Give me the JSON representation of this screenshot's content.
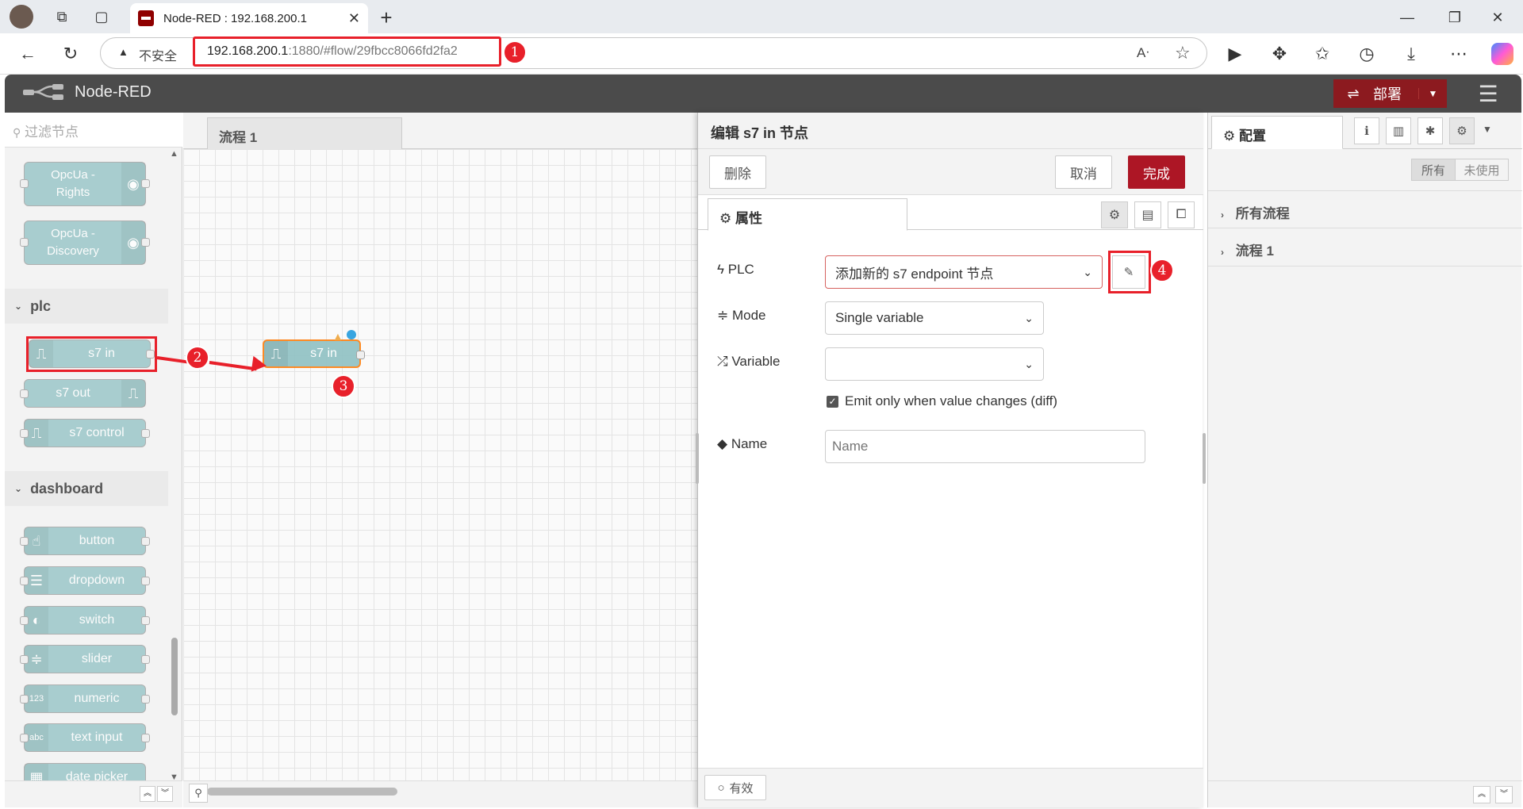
{
  "browser": {
    "tab_title": "Node-RED : 192.168.200.1",
    "insecure_label": "不安全",
    "url_host": "192.168.200.1",
    "url_rest": ":1880/#flow/29fbcc8066fd2fa2"
  },
  "header": {
    "app_name": "Node-RED",
    "deploy_label": "部署"
  },
  "palette": {
    "filter_placeholder": "过滤节点",
    "opcua_nodes": [
      {
        "line1": "OpcUa -",
        "line2": "Rights"
      },
      {
        "line1": "OpcUa -",
        "line2": "Discovery"
      }
    ],
    "plc_category": "plc",
    "plc_nodes": [
      "s7 in",
      "s7 out",
      "s7 control"
    ],
    "dashboard_category": "dashboard",
    "dashboard_nodes": [
      "button",
      "dropdown",
      "switch",
      "slider",
      "numeric",
      "text input",
      "date picker"
    ]
  },
  "workspace": {
    "tab_label": "流程 1",
    "flow_node_label": "s7 in"
  },
  "editor": {
    "title": "编辑 s7 in 节点",
    "delete_label": "删除",
    "cancel_label": "取消",
    "done_label": "完成",
    "properties_tab": "属性",
    "plc_label": "PLC",
    "plc_value": "添加新的 s7 endpoint 节点",
    "mode_label": "Mode",
    "mode_value": "Single variable",
    "variable_label": "Variable",
    "variable_value": "",
    "diff_label": "Emit only when value changes (diff)",
    "diff_checked": true,
    "name_label": "Name",
    "name_placeholder": "Name",
    "status_label": "有效"
  },
  "sidebar": {
    "tab_label": "配置",
    "filter_all": "所有",
    "filter_unused": "未使用",
    "rows": [
      "所有流程",
      "流程 1"
    ]
  },
  "annotations": [
    "1",
    "2",
    "3",
    "4"
  ],
  "colors": {
    "node_red_header": "#4b4b4b",
    "deploy": "#8c1a1f",
    "done_button": "#ad1625",
    "highlight": "#e8202a",
    "node_teal": "#8fc1c3"
  }
}
